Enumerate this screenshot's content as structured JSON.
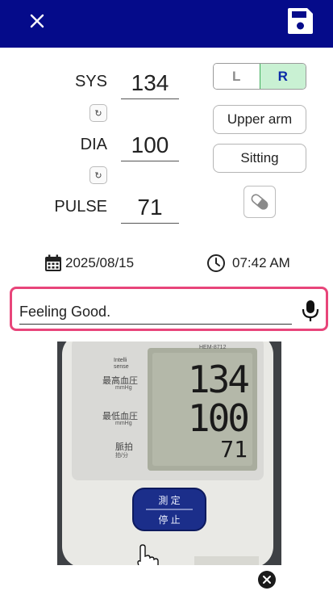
{
  "topbar": {
    "close_icon": "close-icon",
    "save_icon": "floppy-save-icon"
  },
  "readings": {
    "sys": {
      "label": "SYS",
      "value": "134"
    },
    "dia": {
      "label": "DIA",
      "value": "100"
    },
    "pulse": {
      "label": "PULSE",
      "value": "71"
    },
    "swap_glyph": "↻"
  },
  "arm_side": {
    "left": "L",
    "right": "R",
    "selected": "R"
  },
  "position": {
    "location": "Upper arm",
    "posture": "Sitting"
  },
  "medication_icon": "pill-icon",
  "datetime": {
    "date": "2025/08/15",
    "time": "07:42 AM"
  },
  "note": {
    "value": "Feeling Good.",
    "mic_icon": "microphone-icon"
  },
  "photo": {
    "brand_tag": "Intelli sense",
    "model": "HEM-8712",
    "label_sys": "最高血圧",
    "label_sys_unit": "mmHg",
    "label_dia": "最低血圧",
    "label_dia_unit": "mmHg",
    "label_pulse": "脈拍",
    "label_pulse_unit": "拍/分",
    "lcd_sys": "134",
    "lcd_dia": "100",
    "lcd_pulse": "71",
    "button_top": "測 定",
    "button_bottom": "停 止"
  },
  "colors": {
    "topbar": "#050b8a",
    "note_border": "#e8457a",
    "selected_bg": "#c9f1d3",
    "selected_text": "#0b2aa8"
  }
}
